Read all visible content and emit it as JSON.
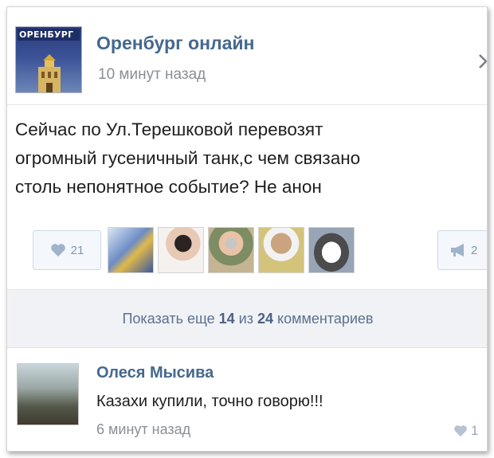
{
  "post": {
    "group_name": "Оренбург онлайн",
    "group_logo_text": "ОРЕНБУРГ",
    "time": "10 минут назад",
    "text": "Сейчас  по Ул.Терешковой перевозят\nогромный гусеничный танк,с чем связано\nстоль непонятное событие? Не анон",
    "likes_count": "21",
    "shares_count": "2",
    "like_icon": "heart-icon",
    "share_icon": "megaphone-icon"
  },
  "show_more": {
    "prefix": "Показать еще",
    "shown": "14",
    "middle": "из",
    "total": "24",
    "suffix": "комментариев"
  },
  "comment": {
    "author": "Олеся Мысива",
    "text": "Казахи купили, точно говорю!!!",
    "time": "6 минут назад",
    "likes_count": "1"
  },
  "colors": {
    "link_blue": "#45688e",
    "muted_gray": "#8a8f96",
    "like_blue": "#7f98b5",
    "panel_bg": "#f0f2f5"
  }
}
